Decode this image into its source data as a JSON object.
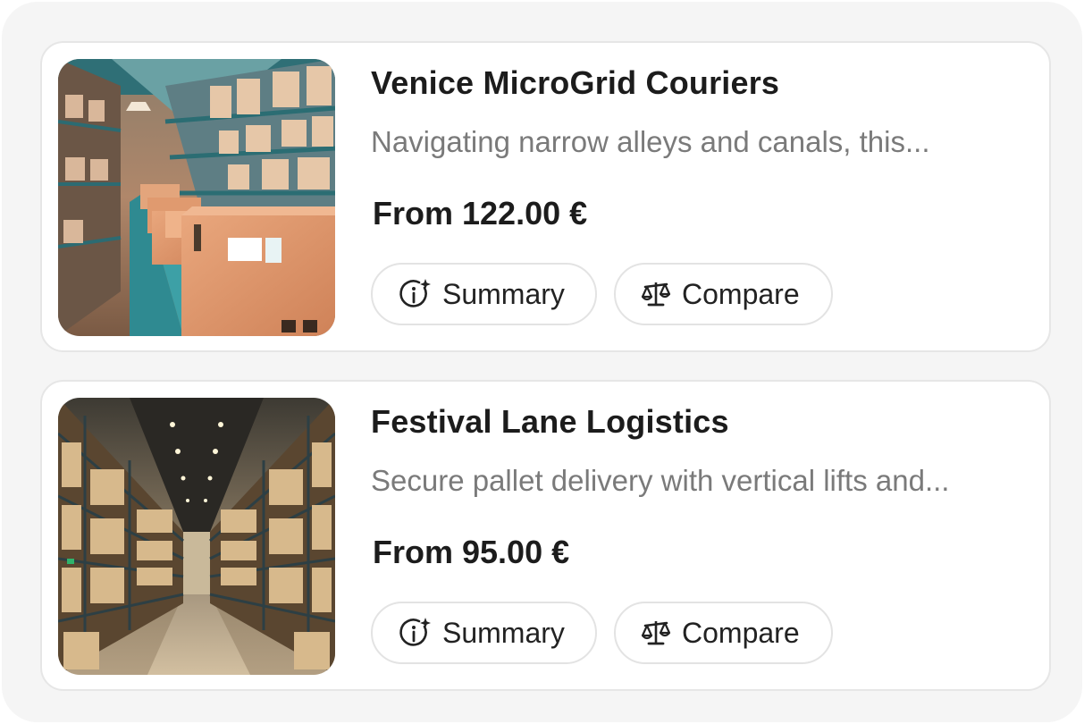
{
  "listings": [
    {
      "title": "Venice MicroGrid Couriers",
      "description": "Navigating narrow alleys and canals, this...",
      "price": "From 122.00 €",
      "summary_label": "Summary",
      "compare_label": "Compare",
      "image": "warehouse-conveyor-boxes-photo"
    },
    {
      "title": "Festival Lane Logistics",
      "description": "Secure pallet delivery with vertical lifts and...",
      "price": "From 95.00 €",
      "summary_label": "Summary",
      "compare_label": "Compare",
      "image": "warehouse-aisle-shelves-photo"
    }
  ],
  "icons": {
    "summary": "info-sparkle-icon",
    "compare": "balance-scale-icon"
  },
  "colors": {
    "title": "#1c1c1c",
    "description": "#7a7a7a",
    "card_border": "#e6e6e6",
    "background": "#f5f5f5"
  }
}
